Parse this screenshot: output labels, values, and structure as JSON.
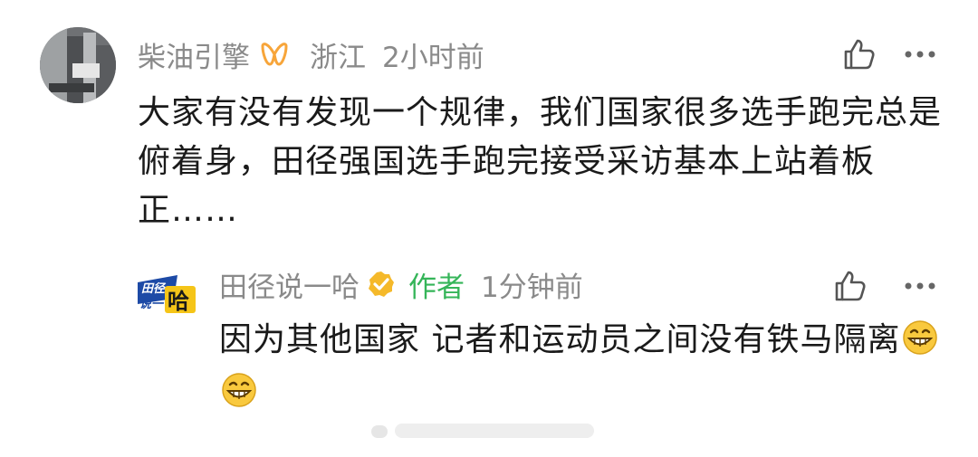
{
  "comment": {
    "username": "柴油引擎",
    "location": "浙江",
    "time": "2小时前",
    "text": "大家有没有发现一个规律，我们国家很多选手跑完总是俯着身，田径强国选手跑完接受采访基本上站着板正……",
    "badge_icon": "weibo-loop-badge-icon"
  },
  "reply": {
    "username": "田径说一哈",
    "author_tag": "作者",
    "time": "1分钟前",
    "text": "因为其他国家 记者和运动员之间没有铁马隔离",
    "emojis": [
      "grin-emoji",
      "grin-emoji"
    ],
    "logo_text": "田径说一哈"
  },
  "colors": {
    "meta_gray": "#8a8a8a",
    "author_green": "#35b559",
    "verified_gold": "#f5b92a",
    "badge_orange": "#f7a53a"
  }
}
